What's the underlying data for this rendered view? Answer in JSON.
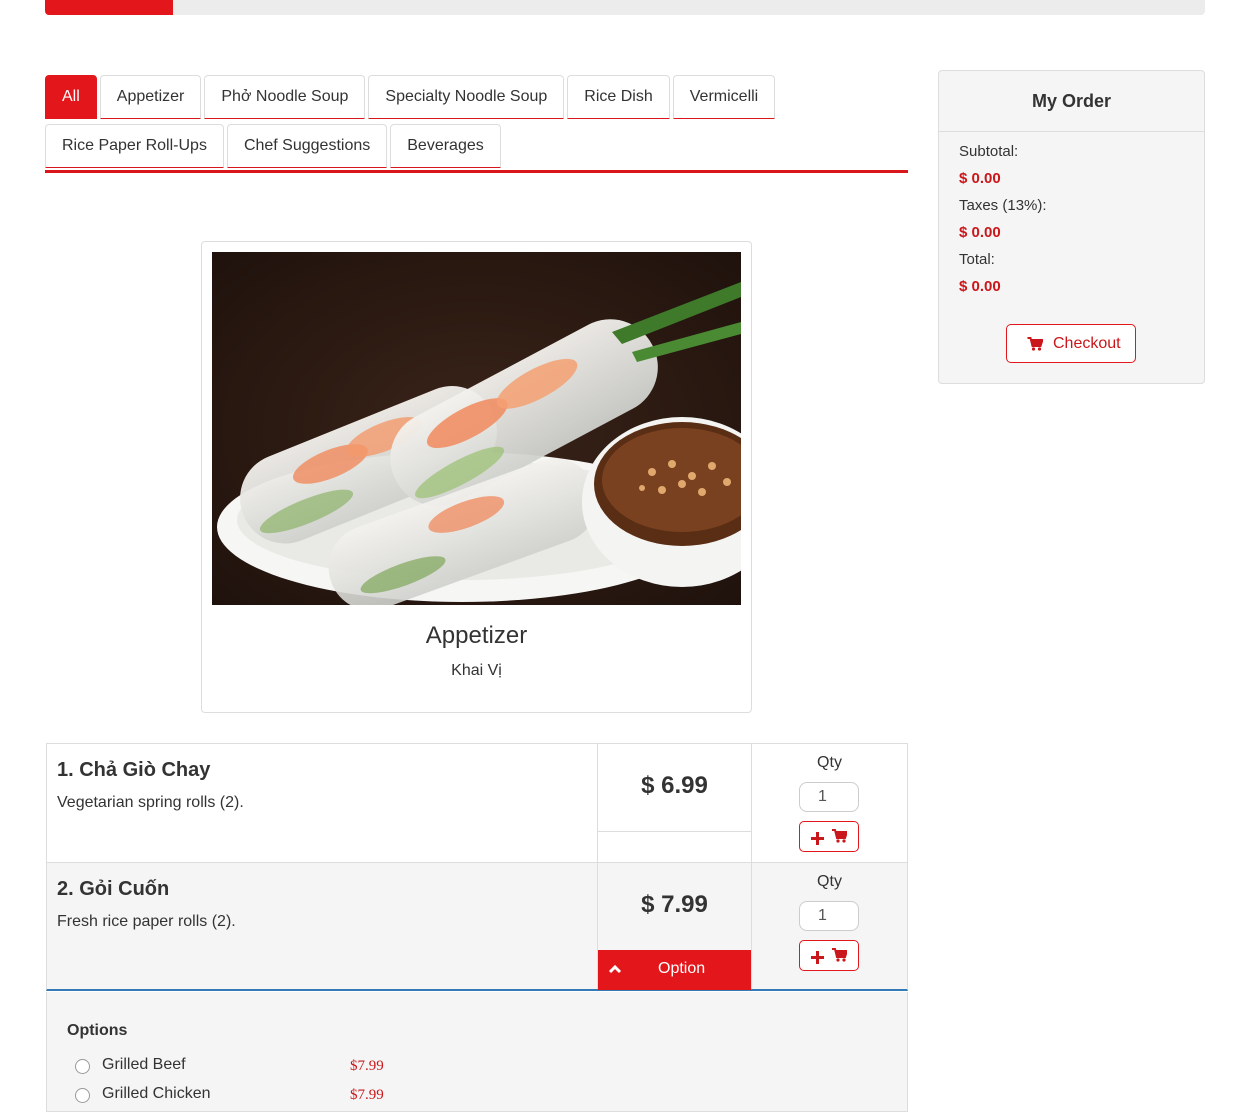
{
  "progress": {
    "value_percent": 11,
    "color": "#e3171b"
  },
  "tabs": {
    "row1": [
      "All",
      "Appetizer",
      "Phở Noodle Soup",
      "Specialty Noodle Soup",
      "Rice Dish",
      "Vermicelli"
    ],
    "row2": [
      "Rice Paper Roll-Ups",
      "Chef Suggestions",
      "Beverages"
    ],
    "active": "All"
  },
  "category": {
    "title": "Appetizer",
    "subtitle": "Khai Vị"
  },
  "items": [
    {
      "name": "1. Chả Giò Chay",
      "description": "Vegetarian spring rolls (2).",
      "price": "$ 6.99",
      "qty_label": "Qty",
      "qty_value": "1"
    },
    {
      "name": "2. Gỏi Cuốn",
      "description": "Fresh rice paper rolls (2).",
      "price": "$ 7.99",
      "qty_label": "Qty",
      "qty_value": "1",
      "option_label": "Option"
    }
  ],
  "options": {
    "title": "Options",
    "list": [
      {
        "name": "Grilled Beef",
        "price": "$7.99"
      },
      {
        "name": "Grilled Chicken",
        "price": "$7.99"
      }
    ]
  },
  "order": {
    "title": "My Order",
    "subtotal_label": "Subtotal:",
    "subtotal_value": "$ 0.00",
    "tax_label": "Taxes (13%):",
    "tax_value": "$ 0.00",
    "total_label": "Total:",
    "total_value": "$ 0.00",
    "checkout_label": "Checkout"
  },
  "colors": {
    "accent": "#e3171b",
    "price_text": "#c9171b",
    "panel_bg": "#f5f5f5",
    "focus_border": "#337ab7"
  }
}
